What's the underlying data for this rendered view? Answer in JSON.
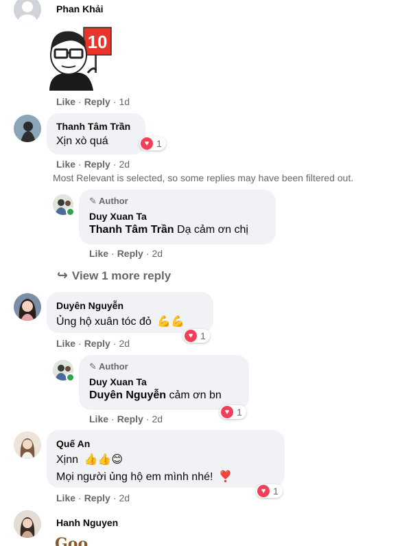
{
  "comments": [
    {
      "name": "Phan Khải",
      "like": "Like",
      "reply": "Reply",
      "time": "1d",
      "sticker_text": "10"
    },
    {
      "name": "Thanh Tâm Trần",
      "text": "Xịn xò quá",
      "reaction_count": "1",
      "like": "Like",
      "reply": "Reply",
      "time": "2d",
      "note": "Most Relevant is selected, so some replies may have been filtered out."
    },
    {
      "name": "Duyên Nguyễn",
      "text": "Ủng hộ xuân tóc đỏ",
      "emoji": "💪💪",
      "reaction_count": "1",
      "like": "Like",
      "reply": "Reply",
      "time": "2d"
    },
    {
      "name": "Quế An",
      "line1": "Xịnn",
      "line1_emoji": "👍👍😊",
      "line2": "Mọi người ủng hộ em mình nhé!",
      "line2_emoji": "❣️",
      "reaction_count": "1",
      "like": "Like",
      "reply": "Reply",
      "time": "2d"
    },
    {
      "name": "Hanh Nguyen",
      "partial_text": "Goo"
    }
  ],
  "replies": [
    {
      "badge": "Author",
      "name": "Duy Xuan Ta",
      "mention": "Thanh Tâm Trần",
      "text": "Dạ cảm ơn chị",
      "like": "Like",
      "reply": "Reply",
      "time": "2d"
    },
    {
      "badge": "Author",
      "name": "Duy Xuan Ta",
      "mention": "Duyên Nguyễn",
      "text": "cảm ơn bn",
      "reaction_count": "1",
      "like": "Like",
      "reply": "Reply",
      "time": "2d"
    }
  ],
  "view_more": {
    "label": "View 1 more reply"
  },
  "colors": {
    "bubble": "#f0f2f5",
    "meta": "#65676b",
    "love": "#f33e58",
    "online": "#31a24c"
  }
}
